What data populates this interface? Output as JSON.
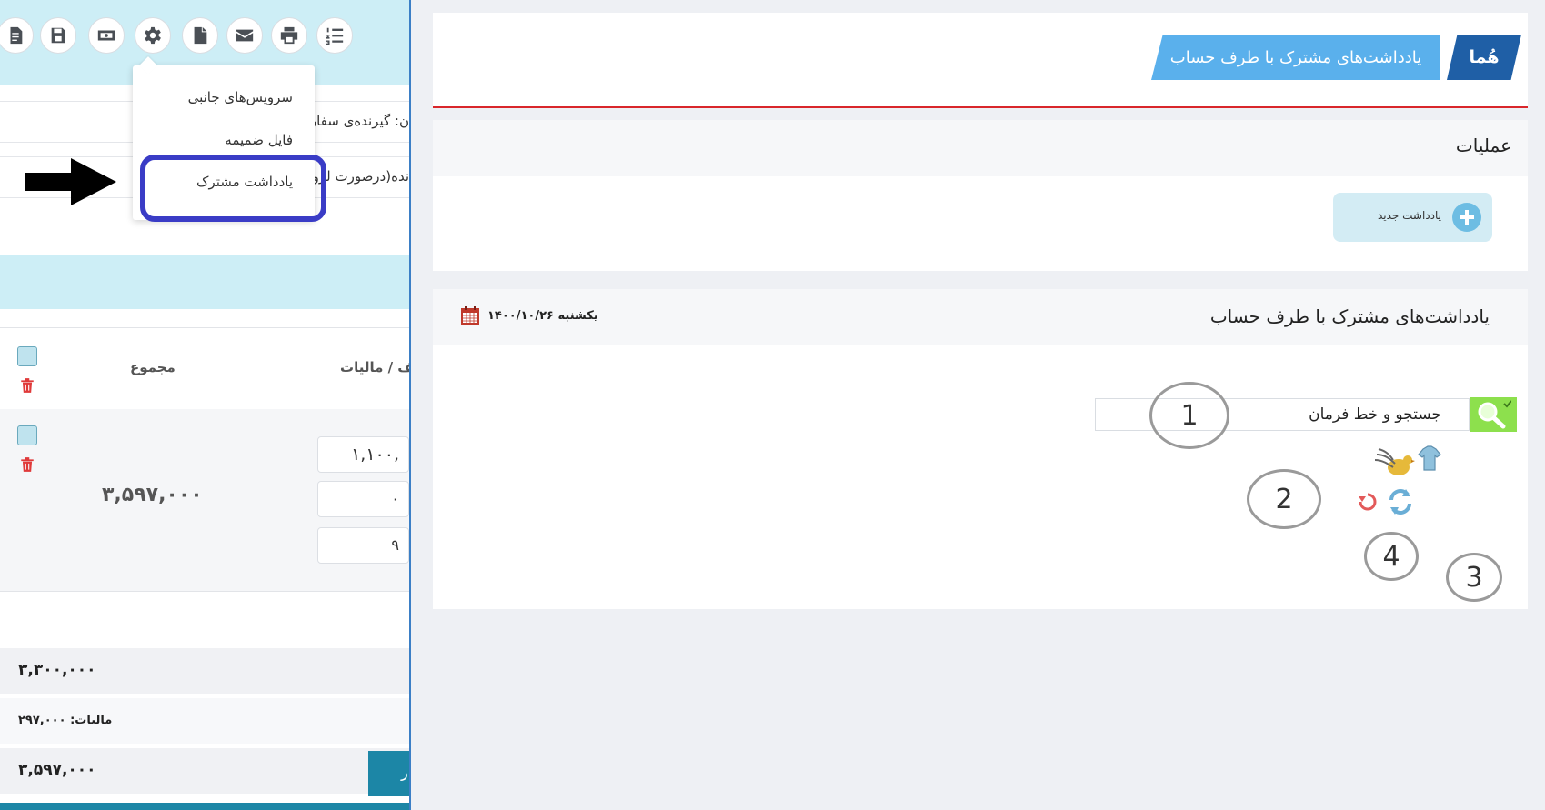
{
  "left": {
    "dropdown": {
      "items": [
        "سرویس‌های جانبی",
        "فایل ضمیمه",
        "یادداشت مشترک"
      ]
    },
    "form": {
      "row1_label": "ن: گیرنده‌ی سفارش",
      "row2_label": "نده(درصورت لزوم"
    },
    "table": {
      "col_total": "مجموع",
      "col_tax": "یف / مالیات",
      "row_total": "۳,۵۹۷,۰۰۰",
      "inputs": [
        "۱,۱۰۰,",
        "۰",
        "۹"
      ]
    },
    "summary": {
      "subtotal": "۳,۳۰۰,۰۰۰",
      "tax_line": "مالیات: ۲۹۷,۰۰۰",
      "grand_total": "۳,۵۹۷,۰۰۰"
    },
    "side_tab_char": "ر"
  },
  "right": {
    "brand": "هُما",
    "banner": "یادداشت‌های مشترک با طرف حساب",
    "operations_title": "عملیات",
    "new_note_label": "یادداشت جدید",
    "notes_title": "یادداشت‌های مشترک با طرف حساب",
    "date": "یکشنبه ۱۴۰۰/۱۰/۲۶",
    "search_value": "جستجو و خط فرمان",
    "annotations": [
      "1",
      "2",
      "3",
      "4"
    ]
  },
  "colors": {
    "toolbar_bg": "#cdeef6",
    "brand_blue": "#1f5fa6",
    "banner_blue": "#5ab0ec",
    "header_red_line": "#d9262b",
    "highlight_box": "#3a3cc6",
    "search_green": "#8de04d"
  }
}
